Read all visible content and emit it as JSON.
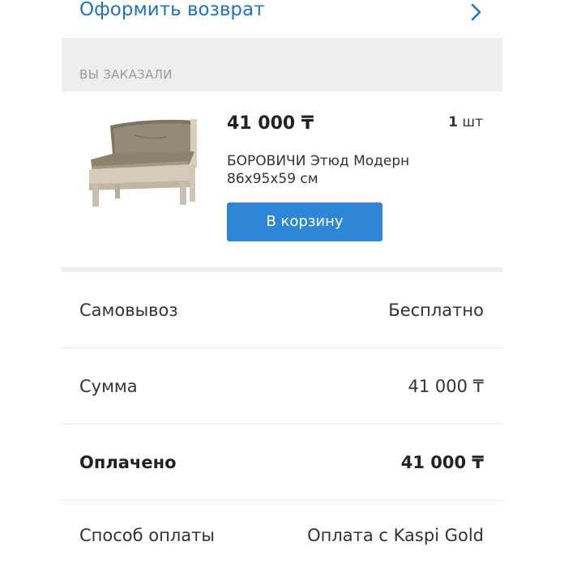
{
  "return_link": {
    "label": "Оформить возврат"
  },
  "order": {
    "section_title": "ВЫ ЗАКАЗАЛИ",
    "item": {
      "price": "41 000 ₸",
      "quantity_number": "1",
      "quantity_unit": "шт",
      "name": "БОРОВИЧИ Этюд Модерн 86x95x59 см",
      "cart_button": "В корзину"
    }
  },
  "summary": [
    {
      "label": "Самовывоз",
      "value": "Бесплатно"
    },
    {
      "label": "Сумма",
      "value": "41 000 ₸"
    },
    {
      "label": "Оплачено",
      "value": "41 000 ₸"
    },
    {
      "label": "Способ оплаты",
      "value": "Оплата с Kaspi Gold"
    }
  ],
  "colors": {
    "link": "#1e73c8",
    "button": "#2f86d6",
    "background": "#eeeeee"
  }
}
